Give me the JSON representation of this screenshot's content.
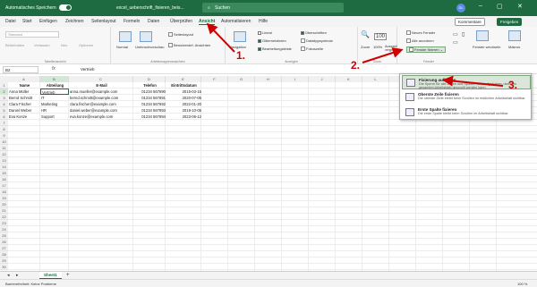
{
  "titlebar": {
    "autosave": "Automatisches Speichern",
    "filename": "excel_ueberschrift_fixieren_beis...",
    "search": "Suchen",
    "user": "DL"
  },
  "menu": {
    "items": [
      "Datei",
      "Start",
      "Einfügen",
      "Zeichnen",
      "Seitenlayout",
      "Formeln",
      "Daten",
      "Überprüfen",
      "Ansicht",
      "Automatisieren",
      "Hilfe"
    ],
    "comments": "Kommentare",
    "share": "Freigeben"
  },
  "ribbon": {
    "sheetview": {
      "default": "Standard",
      "keep": "Beibehalten",
      "exit": "Verlassen",
      "new": "Neu",
      "options": "Optionen",
      "label": "Tabellenansicht"
    },
    "workbook": {
      "normal": "Normal",
      "pagebreak": "Umbruchvorschau",
      "pagelayout": "Seitenlayout",
      "custom": "Benutzerdef. Ansichten",
      "label": "Arbeitsmappenansichten"
    },
    "show": {
      "navigation": "Navigation",
      "ruler": "Lineal",
      "gridlines": "Gitternetzlinien",
      "formulabar": "Bearbeitungsleiste",
      "headings": "Überschriften",
      "focus": "Fokuszelle",
      "label": "Anzeigen",
      "datasym": "Datatippsymbole"
    },
    "zoom": {
      "zoom": "Zoom",
      "hundred": "100%",
      "selection": "Auswahl vergrößern",
      "label": "Zoom"
    },
    "window": {
      "newwin": "Neues Fenster",
      "arrange": "Alle anordnen",
      "freeze": "Fenster fixieren",
      "switch": "Fenster wechseln",
      "macros": "Makros",
      "label": "Fenster"
    }
  },
  "formula": {
    "cell": "B2",
    "fx": "fx",
    "value": "Vertrieb"
  },
  "columns": [
    "A",
    "B",
    "C",
    "D",
    "E",
    "F",
    "G",
    "H",
    "I",
    "J",
    "K",
    "L",
    "M",
    "N",
    "O",
    "P"
  ],
  "rows": [
    "1",
    "2",
    "3",
    "4",
    "5",
    "6",
    "7",
    "8",
    "9",
    "10",
    "11",
    "12",
    "13",
    "14",
    "15",
    "16",
    "17",
    "18",
    "19",
    "20",
    "21",
    "22",
    "23",
    "24",
    "25",
    "26",
    "27",
    "28",
    "29",
    "30"
  ],
  "table": {
    "headers": [
      "Name",
      "Abteilung",
      "E-Mail",
      "Telefon",
      "Eintrittsdatum"
    ],
    "data": [
      [
        "Anna Müller",
        "Vertrieb",
        "anna.mueller@example.com",
        "01234 567890",
        "2015-03-15"
      ],
      [
        "Bernd Schmitt",
        "IT",
        "bernd.schmitt@example.com",
        "01234 567891",
        "2020-07-05"
      ],
      [
        "Clara Fischer",
        "Marketing",
        "clara.fischer@example.com",
        "01234 567892",
        "2022-01-20"
      ],
      [
        "Daniel Weber",
        "HR",
        "daniel.weber@example.com",
        "01234 567893",
        "2019-10-05"
      ],
      [
        "Eva Konze",
        "Support",
        "eva.konze@example.com",
        "01234 567894",
        "2023-06-12"
      ]
    ]
  },
  "dropdown": [
    {
      "title": "Fixierung aufheben",
      "desc": "Die Sperre für alle Zeilen und Spalten wird aufgehoben, damit im gesamten Arbeitsblatt gescrollt werden kann."
    },
    {
      "title": "Oberste Zeile fixieren",
      "desc": "Die oberste Zeile bleibt beim Scrollen im restlichen Arbeitsblatt sichtbar."
    },
    {
      "title": "Erste Spalte fixieren",
      "desc": "Die erste Spalte bleibt beim Scrollen im Arbeitsblatt sichtbar."
    }
  ],
  "annotations": [
    "1.",
    "2.",
    "3."
  ],
  "sheet": {
    "tab": "Sheet1",
    "add": "+"
  },
  "status": {
    "left": "Barrierefreiheit: Keine Probleme",
    "zoom": "100 %"
  },
  "colors": {
    "accent": "#1e6b41",
    "annotation": "#d00000"
  }
}
